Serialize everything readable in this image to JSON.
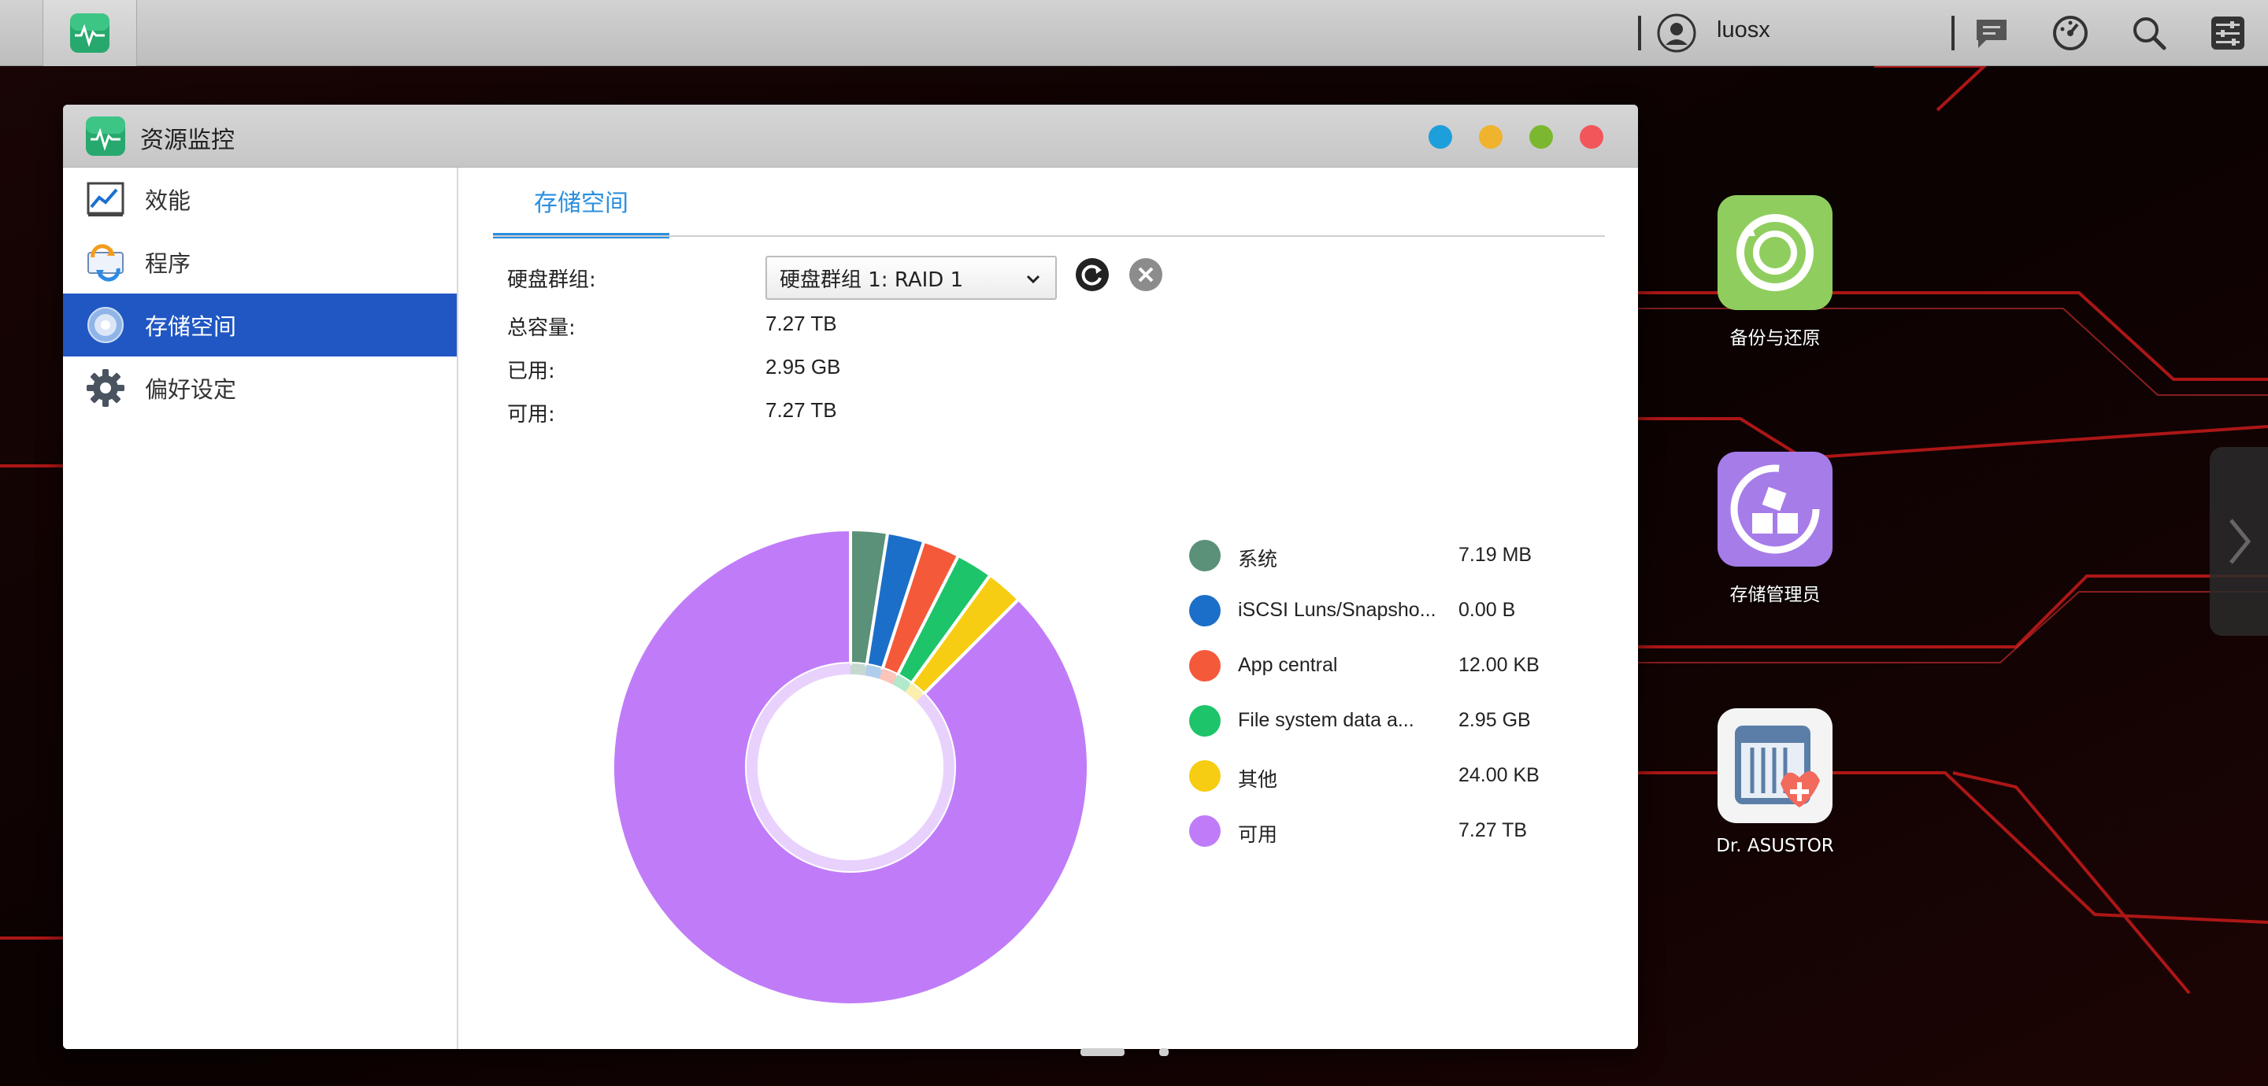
{
  "taskbar": {
    "username": "luosx",
    "icons": [
      "resource-monitor-icon",
      "user-icon",
      "notification-icon",
      "dashboard-icon",
      "search-icon",
      "settings-icon"
    ]
  },
  "window": {
    "title": "资源监控",
    "buttons": [
      "minimize",
      "restore",
      "maximize",
      "close"
    ],
    "button_colors": [
      "#1d9fdb",
      "#f0b32d",
      "#7cb82f",
      "#f2555a"
    ]
  },
  "sidebar": {
    "items": [
      {
        "label": "效能",
        "icon": "performance-chart-icon"
      },
      {
        "label": "程序",
        "icon": "process-icon"
      },
      {
        "label": "存储空间",
        "icon": "storage-disk-icon",
        "active": true
      },
      {
        "label": "偏好设定",
        "icon": "gear-icon"
      }
    ]
  },
  "main": {
    "tab": "存储空间",
    "volume_group": {
      "label": "硬盘群组:",
      "selected": "硬盘群组 1: RAID 1"
    },
    "total": {
      "label": "总容量:",
      "value": "7.27 TB"
    },
    "used": {
      "label": "已用:",
      "value": "2.95 GB"
    },
    "available": {
      "label": "可用:",
      "value": "7.27 TB"
    }
  },
  "chart_data": {
    "type": "pie",
    "donut": true,
    "legend_position": "right",
    "series": [
      {
        "name": "系统",
        "value": "7.19 MB",
        "color": "#5a9178",
        "share": 0.025
      },
      {
        "name": "iSCSI Luns/Snapsho...",
        "value": "0.00 B",
        "color": "#1c6fc9",
        "share": 0.025
      },
      {
        "name": "App central",
        "value": "12.00 KB",
        "color": "#f4593a",
        "share": 0.025
      },
      {
        "name": "File system data a...",
        "value": "2.95 GB",
        "color": "#1ec46a",
        "share": 0.025
      },
      {
        "name": "其他",
        "value": "24.00 KB",
        "color": "#f7cd14",
        "share": 0.025
      },
      {
        "name": "可用",
        "value": "7.27 TB",
        "color": "#c07cf8",
        "share": 0.875
      }
    ]
  },
  "desktop": {
    "apps": [
      {
        "label": "备份与还原",
        "icon": "backup-restore-icon",
        "color": "#8fce5e"
      },
      {
        "label": "存储管理员",
        "icon": "storage-manager-icon",
        "color": "#a67ce9"
      },
      {
        "label": "Dr. ASUSTOR",
        "icon": "dr-asustor-icon",
        "color": "#f4f4f4"
      }
    ]
  }
}
